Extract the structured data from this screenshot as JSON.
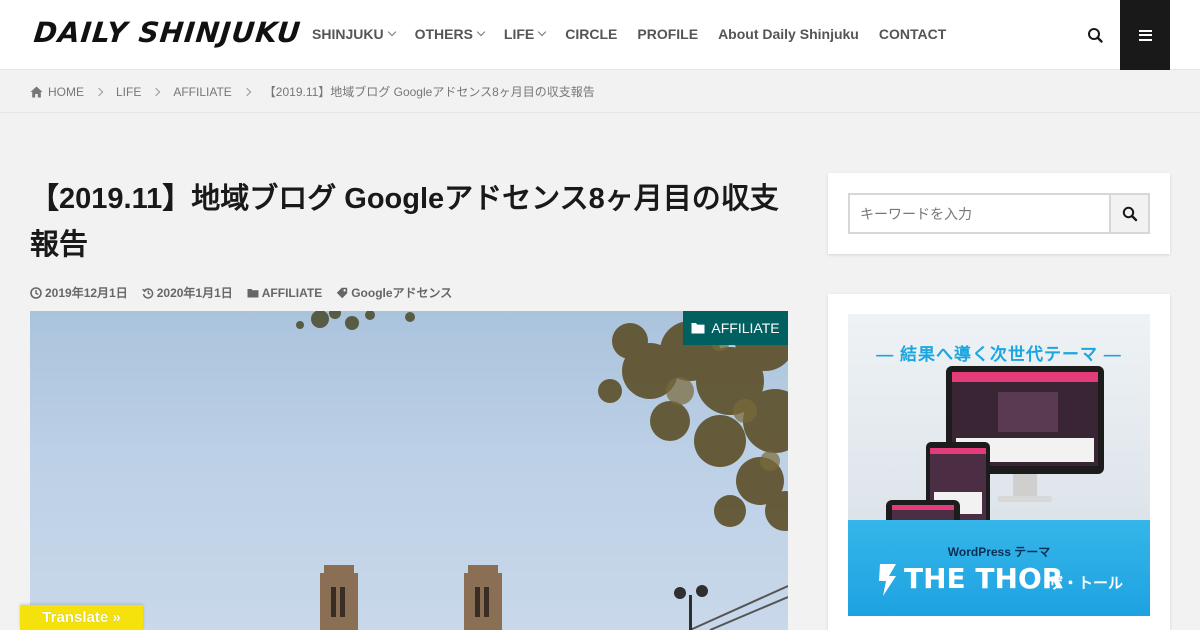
{
  "header": {
    "logo": "DAILY SHINJUKU",
    "nav": [
      {
        "label": "SHINJUKU",
        "has_dropdown": true
      },
      {
        "label": "OTHERS",
        "has_dropdown": true
      },
      {
        "label": "LIFE",
        "has_dropdown": true
      },
      {
        "label": "CIRCLE",
        "has_dropdown": false
      },
      {
        "label": "PROFILE",
        "has_dropdown": false
      },
      {
        "label": "About Daily Shinjuku",
        "has_dropdown": false
      },
      {
        "label": "CONTACT",
        "has_dropdown": false
      }
    ],
    "search_icon": "search-icon",
    "menu_icon": "hamburger-menu-icon"
  },
  "breadcrumb": {
    "home": "HOME",
    "items": [
      "LIFE",
      "AFFILIATE"
    ],
    "current": "【2019.11】地域ブログ Googleアドセンス8ヶ月目の収支報告"
  },
  "article": {
    "title": "【2019.11】地域ブログ Googleアドセンス8ヶ月目の収支報告",
    "published": "2019年12月1日",
    "updated": "2020年1月1日",
    "category": "AFFILIATE",
    "tag": "Googleアドセンス",
    "badge": "AFFILIATE"
  },
  "sidebar": {
    "search_placeholder": "キーワードを入力",
    "ad": {
      "headline": "― 結果へ導く次世代テーマ ―",
      "platform": "WordPress テーマ",
      "product": "THE THOR",
      "product_jp": "ザ・トール"
    }
  },
  "translate": {
    "label": "Translate »"
  },
  "colors": {
    "accent": "#005f5f",
    "menu_bg": "#191919",
    "translate_bg": "#f5e20c",
    "ad_blue": "#1aa6e0"
  }
}
